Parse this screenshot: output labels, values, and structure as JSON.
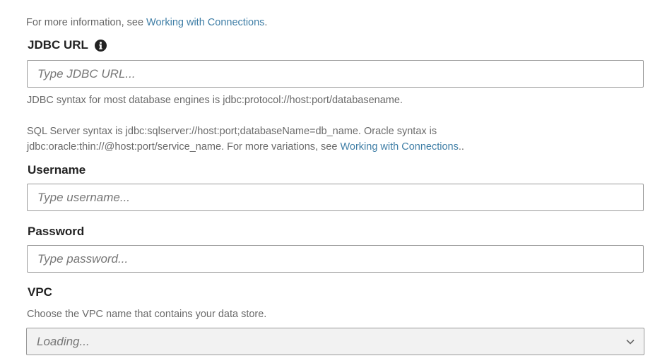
{
  "intro": {
    "prefix": "For more information, see ",
    "link": "Working with Connections",
    "suffix": "."
  },
  "jdbc": {
    "label": "JDBC URL",
    "info_icon": "info-circle-icon",
    "placeholder": "Type JDBC URL...",
    "help1": "JDBC syntax for most database engines is jdbc:protocol://host:port/databasename.",
    "help2_line1": "SQL Server syntax is jdbc:sqlserver://host:port;databaseName=db_name. Oracle syntax is",
    "help2_line2_prefix": "jdbc:oracle:thin://@host:port/service_name. For more variations, see ",
    "help2_link": "Working with Connections",
    "help2_suffix": ".."
  },
  "username": {
    "label": "Username",
    "placeholder": "Type username..."
  },
  "password": {
    "label": "Password",
    "placeholder": "Type password..."
  },
  "vpc": {
    "label": "VPC",
    "help": "Choose the VPC name that contains your data store.",
    "value": "Loading...",
    "chevron_icon": "chevron-down-icon"
  },
  "colors": {
    "link": "#3f7ea6",
    "border": "#9a9a9a",
    "disabled_bg": "#f2f2f2"
  }
}
